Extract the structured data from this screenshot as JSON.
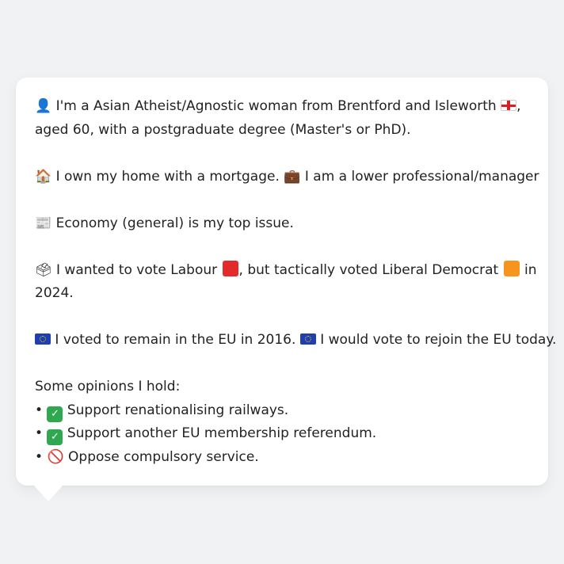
{
  "profile": {
    "line1_a": "I'm a Asian Atheist/Agnostic woman from Brentford and Isleworth",
    "line1_b": ",",
    "line2": "aged 60, with a postgraduate degree (Master's or PhD).",
    "home": "I own my home with a mortgage.",
    "job": "I am a lower professional/manager",
    "issue": "Economy (general) is my top issue.",
    "vote_a": "I wanted to vote Labour",
    "vote_b": ", but tactically voted Liberal Democrat",
    "vote_c": "in",
    "vote_year": "2024.",
    "eu_a": "I voted to remain in the EU in 2016.",
    "eu_b": "I would vote to rejoin the EU today.",
    "opinions_heading": "Some opinions I hold:",
    "opinions": [
      {
        "bullet": "•",
        "mark": "check",
        "text": "Support renationalising railways."
      },
      {
        "bullet": "•",
        "mark": "check",
        "text": "Support another EU membership referendum."
      },
      {
        "bullet": "•",
        "mark": "prohibited",
        "text": "Oppose compulsory service."
      }
    ]
  },
  "icons": {
    "person": "person-silhouette-icon",
    "house": "house-icon",
    "briefcase": "briefcase-icon",
    "newspaper": "newspaper-icon",
    "ballot": "ballot-box-icon",
    "eu_flag": "eu-flag-icon",
    "england_flag": "england-flag-icon"
  },
  "colors": {
    "labour": "#e32b2b",
    "libdem": "#f7941d",
    "check": "#2fa84f",
    "prohibited": "#e0312f"
  }
}
